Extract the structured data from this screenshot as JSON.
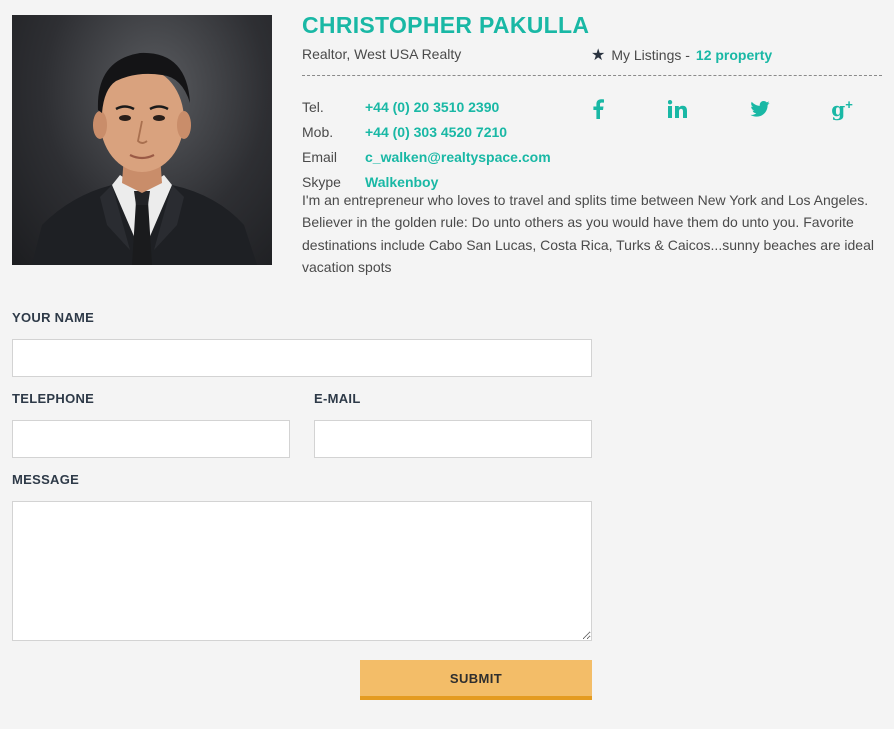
{
  "agent": {
    "name": "CHRISTOPHER PAKULLA",
    "role": "Realtor, West USA Realty",
    "listings_label": "My Listings -",
    "listings_count": "12 property",
    "star_icon": "star-icon"
  },
  "contact": [
    {
      "label": "Tel.",
      "value": "+44 (0) 20 3510 2390"
    },
    {
      "label": "Mob.",
      "value": "+44 (0) 303 4520 7210"
    },
    {
      "label": "Email",
      "value": "c_walken@realtyspace.com"
    },
    {
      "label": "Skype",
      "value": "Walkenboy"
    }
  ],
  "social": [
    {
      "name": "facebook-icon",
      "glyph": "f"
    },
    {
      "name": "linkedin-icon",
      "glyph": "in"
    },
    {
      "name": "twitter-icon",
      "glyph": "t"
    },
    {
      "name": "google-plus-icon",
      "glyph": "g+"
    }
  ],
  "bio": "I'm an entrepreneur who loves to travel and splits time between New York and Los Angeles. Believer in the golden rule: Do unto others as you would have them do unto you. Favorite destinations include Cabo San Lucas, Costa Rica, Turks & Caicos...sunny beaches are ideal vacation spots",
  "form": {
    "name_label": "YOUR NAME",
    "name_value": "",
    "telephone_label": "TELEPHONE",
    "telephone_value": "",
    "email_label": "E-MAIL",
    "email_value": "",
    "message_label": "MESSAGE",
    "message_value": "",
    "submit_label": "SUBMIT"
  },
  "colors": {
    "accent": "#19b8a5",
    "button": "#f3bd68",
    "button_border": "#e49b20",
    "background": "#f4f4f4"
  }
}
